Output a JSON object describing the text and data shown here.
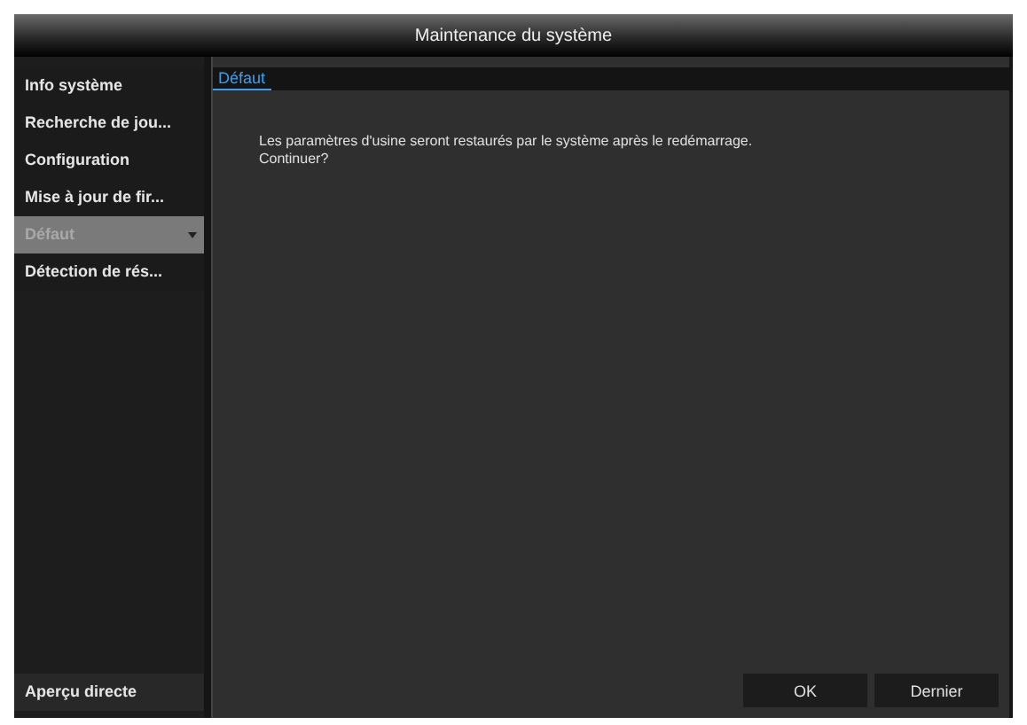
{
  "window": {
    "title": "Maintenance du système"
  },
  "sidebar": {
    "items": [
      {
        "label": "Info système",
        "selected": false
      },
      {
        "label": "Recherche de jou...",
        "selected": false
      },
      {
        "label": "Configuration",
        "selected": false
      },
      {
        "label": "Mise à jour de fir...",
        "selected": false
      },
      {
        "label": "Défaut",
        "selected": true
      },
      {
        "label": "Détection de rés...",
        "selected": false
      }
    ],
    "footer": "Aperçu directe"
  },
  "tabs": [
    {
      "label": "Défaut",
      "selected": true
    }
  ],
  "message": [
    "Les paramètres d'usine seront restaurés par le système après le redémarrage.",
    "Continuer?"
  ],
  "buttons": [
    "OK",
    "Dernier"
  ]
}
